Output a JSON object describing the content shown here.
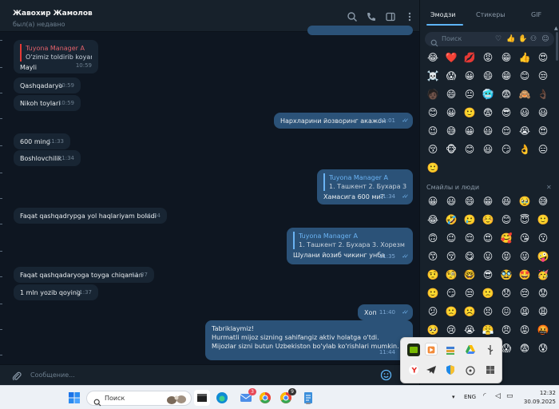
{
  "chat": {
    "contact_name": "Жавохир Жамолов",
    "status": "был(а) недавно"
  },
  "messages": [
    {
      "dir": "in",
      "reply_author": "Tuyona Manager A",
      "reply_text": "O'zimiz toldirib koyamiz",
      "text": "Mayli",
      "time": "10:59"
    },
    {
      "dir": "in",
      "text": "Qashqadaryo",
      "time": "10:59"
    },
    {
      "dir": "in",
      "text": "Nikoh toylari",
      "time": "10:59"
    },
    {
      "dir": "out",
      "text": "Нархларини йозворинг акажон",
      "time": "11:01"
    },
    {
      "dir": "in",
      "text": "600 ming",
      "time": "11:33"
    },
    {
      "dir": "in",
      "text": "Boshlovchilik",
      "time": "11:34"
    },
    {
      "dir": "out",
      "reply_author": "Tuyona Manager A",
      "reply_text": "1. Ташкент 2. Бухара 3. ...",
      "text": "Хамасига 600 ми?",
      "time": "11:34"
    },
    {
      "dir": "in",
      "text": "Faqat qashqadrypga yol haqlariyam boladi",
      "time": "11:34"
    },
    {
      "dir": "out",
      "reply_author": "Tuyona Manager A",
      "reply_text": "1. Ташкент 2. Бухара 3. Хорезм 4. ...",
      "text": "Шулани йозиб чикинг унба",
      "time": "11:35"
    },
    {
      "dir": "in",
      "text": "Faqat qashqadaryoga toyga chiqaman",
      "time": "11:37"
    },
    {
      "dir": "in",
      "text": "1 mln yozib qoying",
      "time": "11:37"
    },
    {
      "dir": "out",
      "text": "Хоп",
      "time": "11:40"
    },
    {
      "dir": "out",
      "lines": [
        "Tabriklaymiz!",
        "Hurmatli mijoz sizning sahifangiz aktiv holatga o'tdi.",
        "Mijozlar sizni butun Uzbekiston bo'ylab ko'rishlari mumkin."
      ],
      "time": "11:44"
    }
  ],
  "composer": {
    "placeholder": "Сообщение..."
  },
  "emoji_panel": {
    "tabs": [
      "Эмодзи",
      "Стикеры",
      "GIF"
    ],
    "active_tab": "Эмодзи",
    "search_placeholder": "Поиск",
    "category_icons": [
      "heart-icon",
      "thumbs-up-icon",
      "hand-icon",
      "person-icon",
      "paw-icon",
      "smile-icon"
    ],
    "recent_emojis": [
      "😂",
      "❤️",
      "💋",
      "😡",
      "😁",
      "👍",
      "😍",
      "☠️",
      "😱",
      "😀",
      "😄",
      "😁",
      "😊",
      "😒",
      "🧑🏿",
      "😄",
      "😐",
      "🥶",
      "😨",
      "🙈",
      "👌🏿",
      "😊",
      "😀",
      "🙂",
      "😨",
      "😎",
      "😃",
      "😃",
      "😉",
      "😅",
      "😀",
      "😃",
      "😌",
      "😭",
      "😍",
      "😚",
      "🐵",
      "😊",
      "😃",
      "😏",
      "👌",
      "😑",
      "🙂"
    ],
    "section_label": "Смайлы и люди",
    "section_close": "✕",
    "people_emojis": [
      "😀",
      "😃",
      "😄",
      "😁",
      "😆",
      "🥹",
      "😅",
      "😂",
      "🤣",
      "🥲",
      "☺️",
      "😊",
      "😇",
      "🙂",
      "🙃",
      "😉",
      "😌",
      "😍",
      "🥰",
      "😘",
      "😗",
      "😙",
      "😚",
      "😋",
      "😛",
      "😝",
      "😜",
      "🤪",
      "🤨",
      "🧐",
      "🤓",
      "😎",
      "🥸",
      "🤩",
      "🥳",
      "🙂",
      "😏",
      "😒",
      "🙁",
      "😞",
      "😔",
      "😟",
      "😕",
      "🙁",
      "☹️",
      "😣",
      "😖",
      "😫",
      "😩",
      "🥺",
      "😢",
      "😭",
      "😤",
      "😠",
      "😡",
      "🤬",
      "🤯",
      "😳",
      "🥵",
      "🥶",
      "😱",
      "😨",
      "😰"
    ]
  },
  "tray_popup": {
    "icons": [
      "nvidia-icon",
      "media-icon",
      "stack-icon",
      "google-drive-icon",
      "usb-icon",
      "cloud-icon",
      "yandex-icon",
      "telegram-icon",
      "shield-icon",
      "wifi-icon",
      "grid-icon"
    ]
  },
  "taskbar": {
    "search_placeholder": "Поиск",
    "chrome_badge": "9",
    "lang": "ENG",
    "time": "12:32",
    "date": "30.09.2025",
    "apps": [
      "windows-start-icon",
      "file-explorer-icon",
      "edge-icon",
      "mail-icon",
      "chrome-icon",
      "chrome-profile-icon",
      "notepad-icon",
      "edge-beta-icon",
      "telegram-icon",
      "chrome-dev-icon",
      "notes-icon"
    ]
  },
  "colors": {
    "chat_bg": "#0e1621",
    "incoming_bubble": "#182533",
    "outgoing_bubble": "#2b5278",
    "accent": "#5eb5f7",
    "reply_in_accent": "#e53935"
  }
}
